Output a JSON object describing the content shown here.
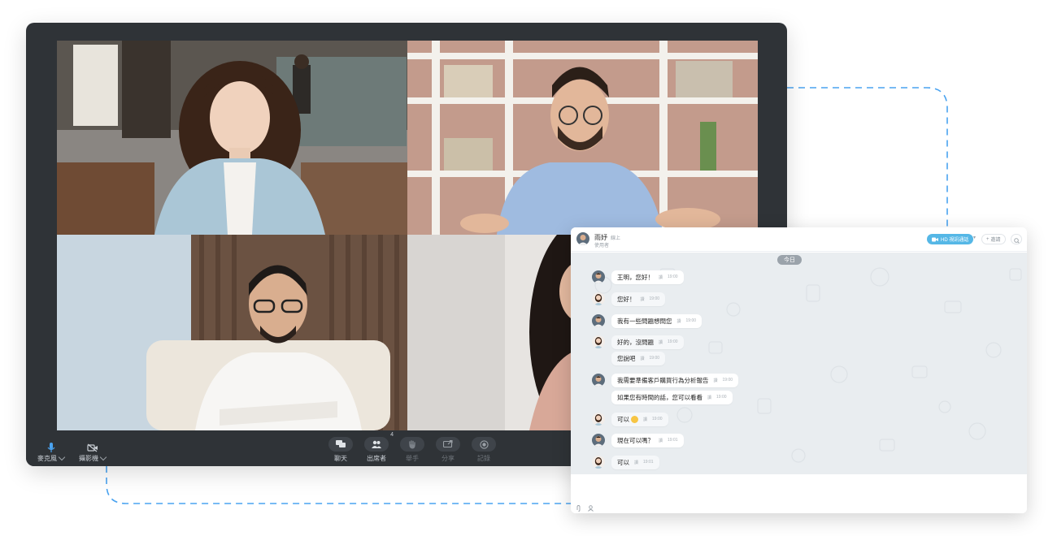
{
  "meeting": {
    "controls_left": [
      {
        "label": "麥克風",
        "icon": "microphone-icon",
        "color": "#4aa3f0"
      },
      {
        "label": "攝影機",
        "icon": "camera-off-icon",
        "color": "#c9ced4"
      }
    ],
    "controls_center": [
      {
        "label": "聊天",
        "icon": "chat-icon",
        "badge": ""
      },
      {
        "label": "出席者",
        "icon": "participants-icon",
        "badge": "4"
      },
      {
        "label": "舉手",
        "icon": "raise-hand-icon",
        "badge": ""
      },
      {
        "label": "分享",
        "icon": "share-screen-icon",
        "badge": ""
      },
      {
        "label": "記錄",
        "icon": "record-icon",
        "badge": ""
      }
    ]
  },
  "chat": {
    "header": {
      "name": "雨妤",
      "status": "線上",
      "role": "使用者",
      "call_button": "HD 視訊通話",
      "add_button": "邀請"
    },
    "date_divider": "今日",
    "messages": [
      {
        "sender": "male",
        "text": "王明，您好！",
        "time": "19:00",
        "read": "讀"
      },
      {
        "sender": "female",
        "text": "您好！",
        "time": "19:00",
        "read": "讀"
      },
      {
        "sender": "male",
        "text": "我有一些問題想問您",
        "time": "19:00",
        "read": "讀"
      },
      {
        "sender": "female",
        "text": "好的，沒問題",
        "time": "19:00",
        "read": "讀"
      },
      {
        "sender": "female",
        "text": "您說吧",
        "time": "19:00",
        "read": "讀"
      },
      {
        "sender": "male",
        "text": "我需要準備客戶購買行為分析報告",
        "time": "19:00",
        "read": "讀"
      },
      {
        "sender": "male",
        "text": "如果您有時間的話，您可以看看",
        "time": "19:00",
        "read": "讀"
      },
      {
        "sender": "female",
        "text": "可以",
        "time": "19:00",
        "read": "讀",
        "emoji": "smile"
      },
      {
        "sender": "male",
        "text": "現在可以嗎？",
        "time": "19:01",
        "read": "讀"
      },
      {
        "sender": "female",
        "text": "可以",
        "time": "19:01",
        "read": "讀"
      }
    ],
    "input_tools": [
      "attachment-icon",
      "user-icon"
    ]
  },
  "colors": {
    "meeting_bg": "#2f3337",
    "accent": "#55b7e6",
    "dashed_line": "#4aa3f0",
    "chat_bg": "#e9edf0"
  }
}
